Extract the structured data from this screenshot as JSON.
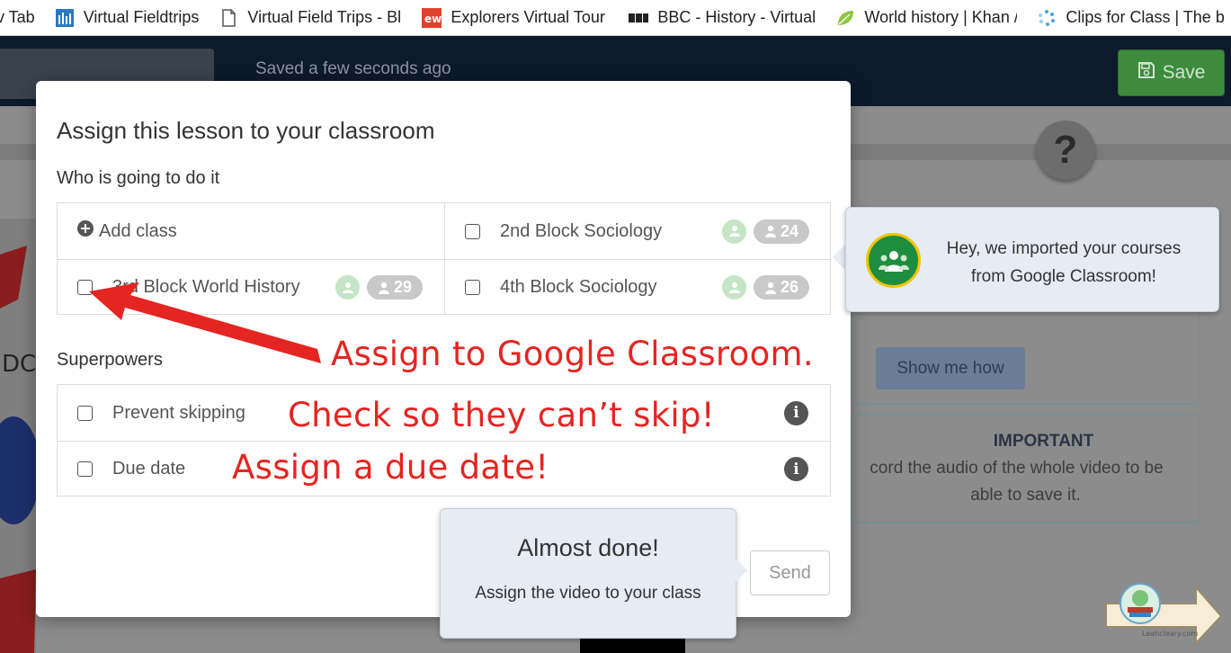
{
  "bookmarks": [
    {
      "label": "v Tab",
      "icon": "none"
    },
    {
      "label": "Virtual Fieldtrips",
      "icon": "blue-tile-icon"
    },
    {
      "label": "Virtual Field Trips - Bl",
      "icon": "document-icon"
    },
    {
      "label": "Explorers Virtual Tour",
      "icon": "ew-logo-icon"
    },
    {
      "label": "BBC - History - Virtual",
      "icon": "bbc-logo-icon"
    },
    {
      "label": "World history | Khan /",
      "icon": "leaf-icon"
    },
    {
      "label": "Clips for Class | The b",
      "icon": "spinner-icon"
    }
  ],
  "header": {
    "saved_status": "Saved a few seconds ago",
    "save_label": "Save"
  },
  "background": {
    "help_symbol": "?",
    "show_me_how": "Show me how",
    "important_title": "IMPORTANT",
    "important_line1": "cord the audio of the whole video to be",
    "important_line2": "able to save it."
  },
  "modal": {
    "title": "Assign this lesson to your classroom",
    "who_label": "Who is going to do it",
    "add_class": "Add class",
    "classes": [
      {
        "name": "2nd Block Sociology",
        "count": "24"
      },
      {
        "name": "3rd Block World History",
        "count": "29"
      },
      {
        "name": "4th Block Sociology",
        "count": "26"
      }
    ],
    "superpowers_label": "Superpowers",
    "superpowers": [
      {
        "name": "Prevent skipping"
      },
      {
        "name": "Due date"
      }
    ],
    "send_label": "Send"
  },
  "tooltips": {
    "google_classroom_msg": "Hey, we imported your courses from Google Classroom!",
    "almost_done_title": "Almost done!",
    "almost_done_body": "Assign the video to your class"
  },
  "annotations": {
    "assign": "Assign to Google Classroom.",
    "skip": "Check so they can’t skip!",
    "due": "Assign a due date!"
  },
  "watermark": {
    "site": "Leahcleary.com"
  },
  "colors": {
    "save_green": "#3d8b3d",
    "annotation_red": "#e52521",
    "google_classroom_green": "#1e8e3e",
    "tooltip_bg": "#e6ebf4"
  }
}
